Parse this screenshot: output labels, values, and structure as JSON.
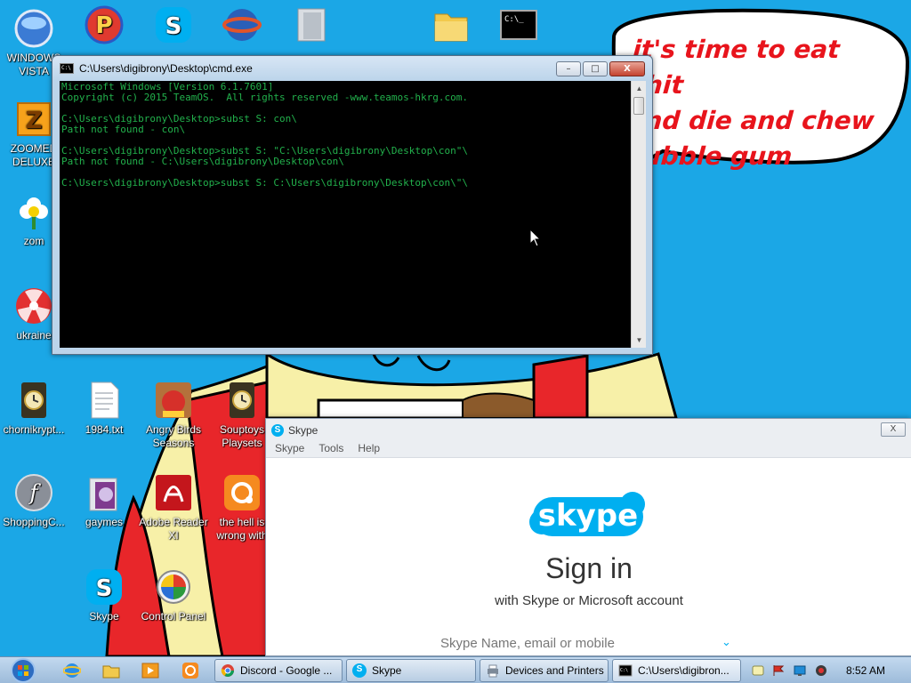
{
  "speech_bubble": {
    "lines": [
      "it's time to eat shit",
      "and die and chew",
      "bubble gum"
    ]
  },
  "desktop_icons": [
    {
      "label": "WINDOWS VISTA"
    },
    {
      "label": "ZOOMED DELUXE"
    },
    {
      "label": "zom"
    },
    {
      "label": "ukraine"
    },
    {
      "label": "chornikrypt..."
    },
    {
      "label": "1984.txt"
    },
    {
      "label": "Angry Birds Seasons"
    },
    {
      "label": "Souptoys Playsets"
    },
    {
      "label": "ShoppingC..."
    },
    {
      "label": "gaymes"
    },
    {
      "label": "Adobe Reader XI"
    },
    {
      "label": "the hell is wrong with"
    },
    {
      "label": "Skype"
    },
    {
      "label": "Control Panel"
    }
  ],
  "cmd_window": {
    "title": "C:\\Users\\digibrony\\Desktop\\cmd.exe",
    "minimize": "–",
    "maximize": "□",
    "close": "X",
    "lines": [
      "Microsoft Windows [Version 6.1.7601]",
      "Copyright (c) 2015 TeamOS.  All rights reserved -www.teamos-hkrg.com.",
      "",
      "C:\\Users\\digibrony\\Desktop>subst S: con\\",
      "Path not found - con\\",
      "",
      "C:\\Users\\digibrony\\Desktop>subst S: \"C:\\Users\\digibrony\\Desktop\\con\"\\",
      "Path not found - C:\\Users\\digibrony\\Desktop\\con\\",
      "",
      "C:\\Users\\digibrony\\Desktop>subst S: C:\\Users\\digibrony\\Desktop\\con\\\"\\"
    ]
  },
  "skype_window": {
    "title": "Skype",
    "close": "X",
    "menu": [
      "Skype",
      "Tools",
      "Help"
    ],
    "logo_text": "skype",
    "heading": "Sign in",
    "subheading": "with Skype or Microsoft account",
    "field_placeholder": "Skype Name, email or mobile",
    "field_chevron": "⌄"
  },
  "taskbar": {
    "tasks": [
      {
        "label": "Discord - Google ..."
      },
      {
        "label": "Skype"
      },
      {
        "label": "Devices and Printers"
      },
      {
        "label": "C:\\Users\\digibron..."
      }
    ],
    "clock": "8:52 AM"
  },
  "colors": {
    "desktop_bg": "#1ba7e6",
    "console_text": "#22b14c",
    "skype_blue": "#00aff0",
    "bubble_text": "#e8141c"
  }
}
